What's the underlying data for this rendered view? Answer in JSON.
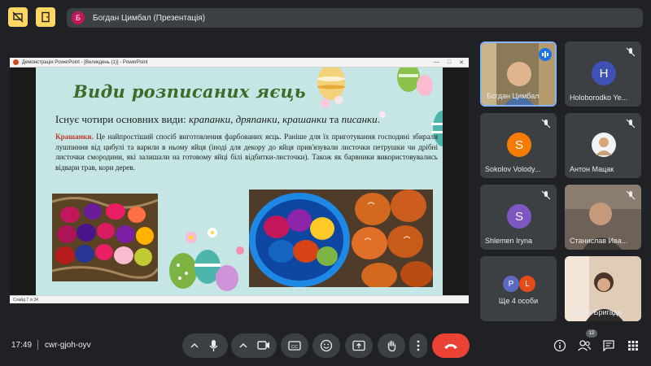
{
  "presenter": {
    "avatar_letter": "Б",
    "label": "Богдан Цимбал (Презентація)"
  },
  "pres_window": {
    "title": "Демонстрація PowerPoint - [Великдень (1)] - PowerPoint",
    "status": "Слайд 7 із 34"
  },
  "slide": {
    "title": "Види розписаних яєць",
    "intro_prefix": "Існує чотири основних види: ",
    "intro_kinds": [
      "крапанки",
      "дряпанки",
      "крашанки",
      "писанки"
    ],
    "intro_sep": ", ",
    "intro_and": " та ",
    "intro_end": ".",
    "body_term": "Крашанки.",
    "body_text": " Це найпростіший спосіб виготовлення фарбованих яєць. Раніше для їх приготування господині збирали лушпиння від цибулі та варили в ньому яйця (іноді для декору до яйця прив'язували листочки петрушки чи дрібні листочки смородини, які залишали на готовому яйці білі відбитки-листочки). Також як барвники використовувались відвари трав, кори дерев."
  },
  "participants": [
    {
      "name": "Богдан Цимбал",
      "type": "video"
    },
    {
      "name": "Holoborodko Ye...",
      "avatar": "H",
      "color": "#3f51b5"
    },
    {
      "name": "Sokolov Volody...",
      "avatar": "S",
      "color": "#f57c00"
    },
    {
      "name": "Антон Мацак",
      "type": "photo"
    },
    {
      "name": "Shlemen Iryna",
      "avatar": "S",
      "color": "#7e57c2"
    },
    {
      "name": "Станислав Ива...",
      "type": "video"
    },
    {
      "name": "Ще 4 особи",
      "avatars": [
        "P",
        "L"
      ],
      "colors": [
        "#5c6bc0",
        "#e64a19"
      ]
    },
    {
      "name": "Олена Бригада",
      "type": "video"
    }
  ],
  "bottom": {
    "time": "17:49",
    "meeting_code": "cwr-gjoh-oyv",
    "participant_count": "12"
  },
  "colors": {
    "end_call": "#ea4335",
    "top_buttons": "#fdd663",
    "speaking": "#1a73e8"
  }
}
